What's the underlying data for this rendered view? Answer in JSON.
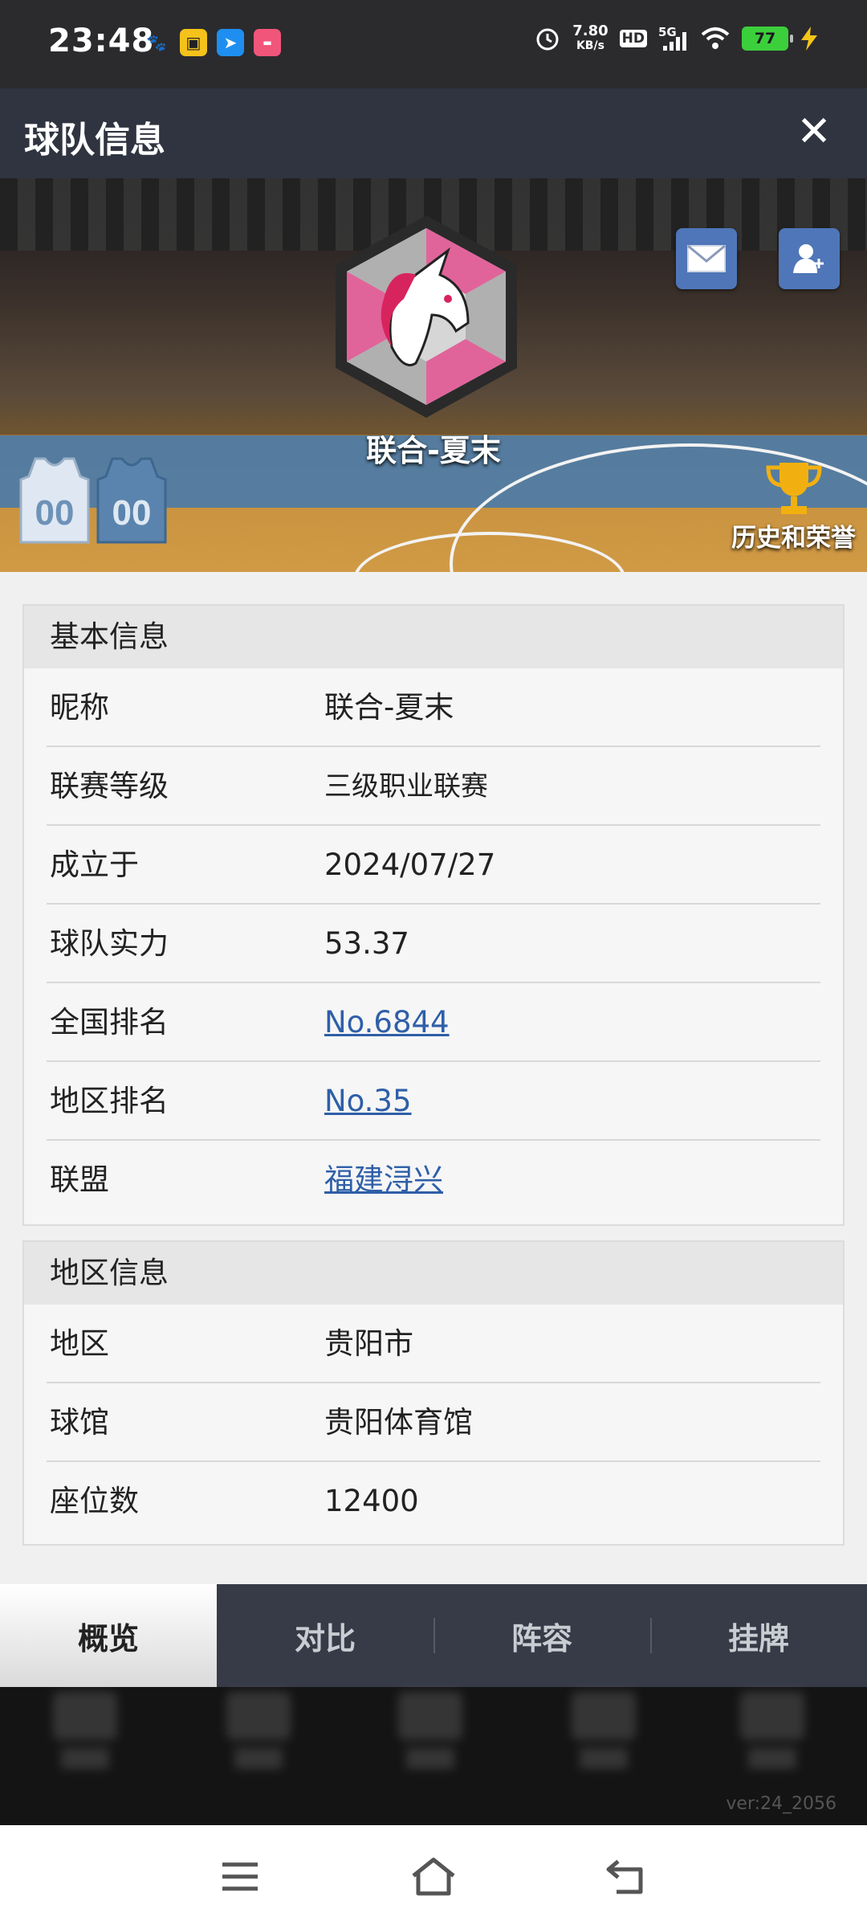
{
  "status_bar": {
    "time": "23:48",
    "net_speed_value": "7.80",
    "net_speed_unit": "KB/s",
    "hd": "HD",
    "network": "5G",
    "battery": "77"
  },
  "title_bar": {
    "title": "球队信息",
    "close": "✕"
  },
  "banner": {
    "team_name": "联合-夏末",
    "honor_label": "历史和荣誉",
    "jersey_number": "00"
  },
  "basic_info": {
    "header": "基本信息",
    "rows": [
      {
        "label": "昵称",
        "value": "联合-夏末"
      },
      {
        "label": "联赛等级",
        "value": "三级职业联赛"
      },
      {
        "label": "成立于",
        "value": "2024/07/27"
      },
      {
        "label": "球队实力",
        "value": "53.37"
      },
      {
        "label": "全国排名",
        "value": "No.6844"
      },
      {
        "label": "地区排名",
        "value": "No.35"
      },
      {
        "label": "联盟",
        "value": "福建浔兴"
      }
    ]
  },
  "region_info": {
    "header": "地区信息",
    "rows": [
      {
        "label": "地区",
        "value": "贵阳市"
      },
      {
        "label": "球馆",
        "value": "贵阳体育馆"
      },
      {
        "label": "座位数",
        "value": "12400"
      }
    ]
  },
  "tabs": [
    {
      "label": "概览",
      "active": true
    },
    {
      "label": "对比",
      "active": false
    },
    {
      "label": "阵容",
      "active": false
    },
    {
      "label": "挂牌",
      "active": false
    }
  ],
  "version": "ver:24_2056",
  "colors": {
    "title_bar": "#2f3440",
    "link": "#2f5fa8",
    "icon_button": "#4f76b8",
    "tab_bar": "#363b47"
  }
}
